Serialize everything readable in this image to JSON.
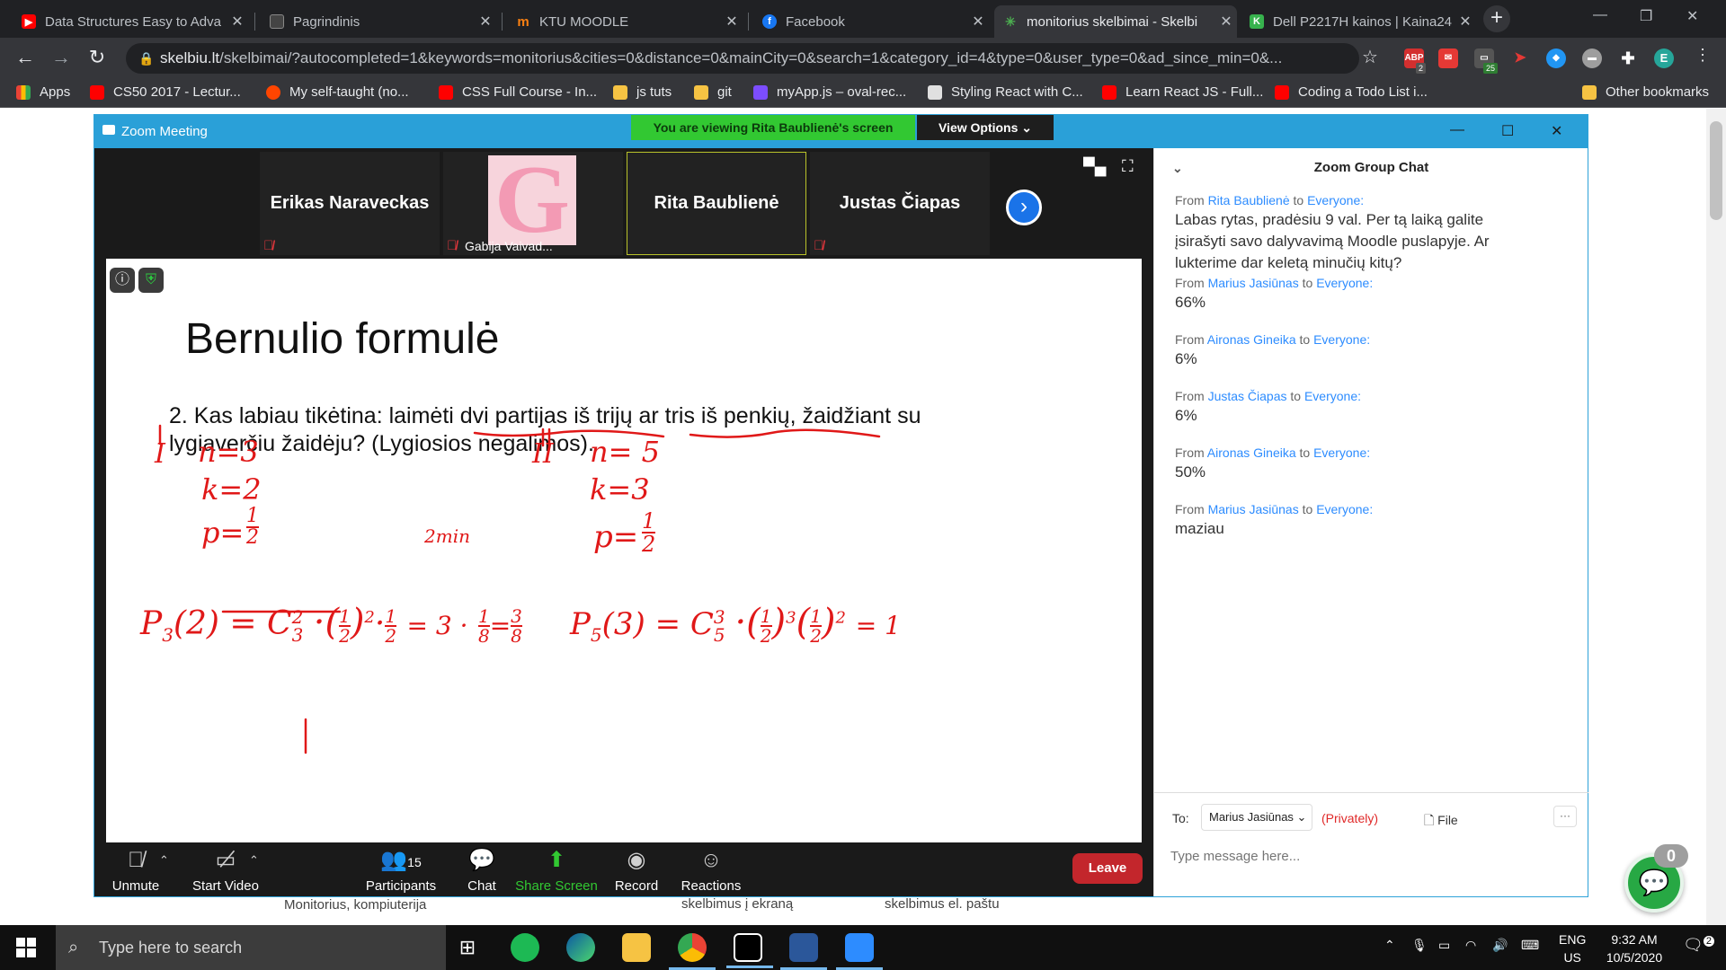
{
  "browser": {
    "tabs": [
      {
        "title": "Data Structures Easy to Adva",
        "favicon_color": "#ff0000",
        "active": false
      },
      {
        "title": "Pagrindinis",
        "favicon_color": "#222222",
        "active": false
      },
      {
        "title": "KTU MOODLE",
        "favicon_color": "#f98012",
        "favicon_text": "m",
        "active": false
      },
      {
        "title": "Facebook",
        "favicon_color": "#1877f2",
        "favicon_text": "f",
        "active": false
      },
      {
        "title": "monitorius skelbimai - Skelbi",
        "favicon_color": "#4caf50",
        "active": true
      },
      {
        "title": "Dell P2217H kainos | Kaina24",
        "favicon_color": "#37b24d",
        "favicon_text": "K",
        "active": false
      }
    ],
    "url_host": "skelbiu.lt",
    "url_rest": "/skelbimai/?autocompleted=1&keywords=monitorius&cities=0&distance=0&mainCity=0&search=1&category_id=4&type=0&user_type=0&ad_since_min=0&...",
    "extensions": {
      "abp_badge": "2",
      "ext3_badge": "25",
      "profile_initial": "E"
    },
    "bookmarks": [
      {
        "label": "Apps",
        "icon_color": "#ea4335"
      },
      {
        "label": "CS50 2017 - Lectur...",
        "icon_color": "#ff0000"
      },
      {
        "label": "My self-taught (no...",
        "icon_color": "#ff4500"
      },
      {
        "label": "CSS Full Course - In...",
        "icon_color": "#ff0000"
      },
      {
        "label": "js tuts",
        "icon_color": "#f6c343"
      },
      {
        "label": "git",
        "icon_color": "#f6c343"
      },
      {
        "label": "myApp.js – oval-rec...",
        "icon_color": "#7c4dff"
      },
      {
        "label": "Styling React with C...",
        "icon_color": "#e0e0e0"
      },
      {
        "label": "Learn React JS - Full...",
        "icon_color": "#ff0000"
      },
      {
        "label": "Coding a Todo List i...",
        "icon_color": "#ff0000"
      }
    ],
    "other_bookmarks": "Other bookmarks"
  },
  "background_page": {
    "text1": "Monitorius, kompiuterija",
    "text2": "skelbimus į ekraną",
    "text3": "skelbimus el. paštu"
  },
  "zoom": {
    "window_title": "Zoom Meeting",
    "viewing_banner": "You are viewing Rita Baublienė's screen",
    "view_options": "View Options ⌄",
    "participants_strip": [
      {
        "name": "Erikas Naraveckas",
        "muted": true
      },
      {
        "name": "Gabija Vaivad...",
        "muted": true,
        "avatar_letter": "G"
      },
      {
        "name": "Rita Baublienė",
        "muted": false,
        "speaking": true
      },
      {
        "name": "Justas Čiapas",
        "muted": true
      }
    ],
    "slide": {
      "title": "Bernulio formulė",
      "question": "2. Kas labiau tikėtina: laimėti dvi partijas iš trijų ar tris iš penkių, žaidžiant su lygiaverčiu žaidėju? (Lygiosios negalimos).",
      "handwriting": {
        "case1_label": "I",
        "case1_n": "n=3",
        "case1_k": "k=2",
        "case1_p": "p=",
        "case2_label": "II",
        "case2_n": "n= 5",
        "case2_k": "k=3",
        "case2_p": "p=",
        "timer_note": "2min",
        "formula1_lhs": "P",
        "formula1_sub": "3",
        "formula1_arg": "(2) = C",
        "formula1_c_sup": "2",
        "formula1_c_sub": "3",
        "formula1_rest": "= 3 ·",
        "formula2_lhs": "P",
        "formula2_sub": "5",
        "formula2_arg": "(3) = C",
        "formula2_c_sup": "3",
        "formula2_c_sub": "5",
        "formula2_rest": "= 1",
        "half_num": "1",
        "half_den": "2",
        "eighth_num": "1",
        "eighth_den": "8",
        "three_eighths_num": "3",
        "three_eighths_den": "8",
        "exp_2": "2",
        "exp_3": "3"
      }
    },
    "toolbar": {
      "unmute": "Unmute",
      "start_video": "Start Video",
      "participants": "Participants",
      "participants_count": "15",
      "chat": "Chat",
      "share_screen": "Share Screen",
      "record": "Record",
      "reactions": "Reactions",
      "leave": "Leave"
    },
    "chat": {
      "title": "Zoom Group Chat",
      "messages": [
        {
          "from": "Rita Baublienė",
          "to": "Everyone:",
          "text": "Labas rytas, pradėsiu 9 val. Per tą laiką galite įsirašyti savo dalyvavimą Moodle puslapyje. Ar lukterime dar keletą minučių kitų?"
        },
        {
          "from": "Marius Jasiūnas",
          "to": "Everyone:",
          "text": "66%"
        },
        {
          "from": "Aironas Gineika",
          "to": "Everyone:",
          "text": "6%"
        },
        {
          "from": "Justas Čiapas",
          "to": "Everyone:",
          "text": "6%"
        },
        {
          "from": "Aironas Gineika",
          "to": "Everyone:",
          "text": "50%"
        },
        {
          "from": "Marius Jasiūnas",
          "to": "Everyone:",
          "text": "maziau"
        }
      ],
      "from_word": "From",
      "to_word": "to",
      "to_label": "To:",
      "recipient": "Marius Jasiūnas ⌄",
      "privately": "(Privately)",
      "file": "File",
      "more": "···",
      "input_placeholder": "Type message here..."
    },
    "floating_chat_badge": "0"
  },
  "taskbar": {
    "search_placeholder": "Type here to search",
    "lang_top": "ENG",
    "lang_bottom": "US",
    "time": "9:32 AM",
    "date": "10/5/2020",
    "notif_count": "2"
  }
}
